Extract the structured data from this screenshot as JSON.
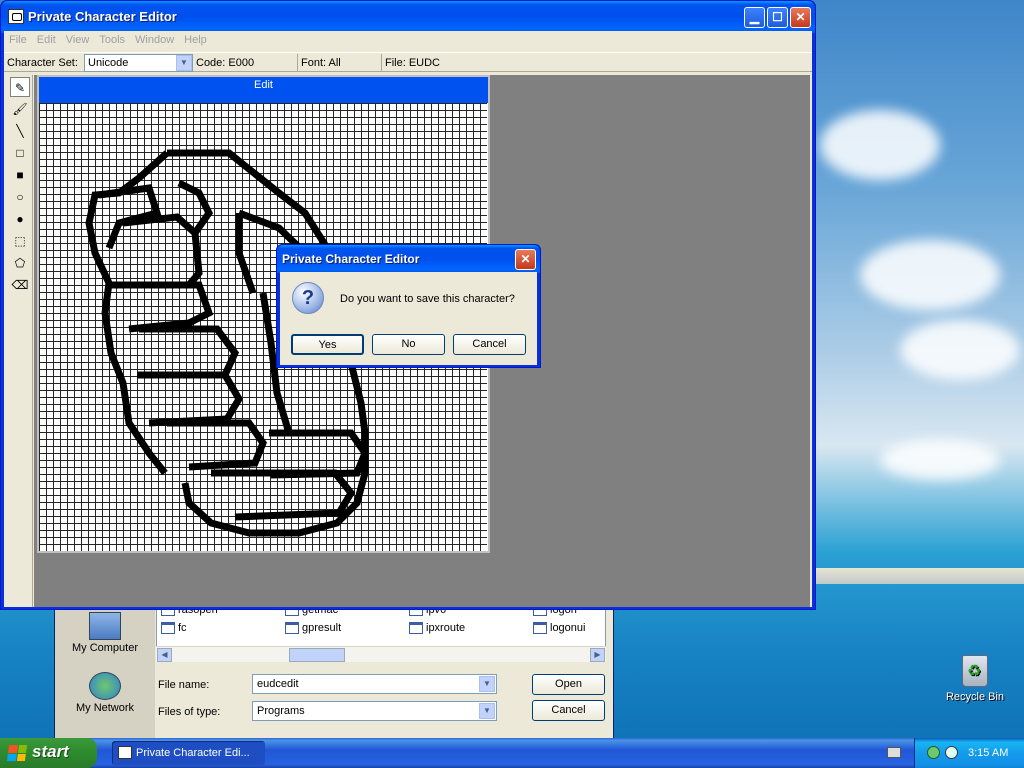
{
  "window": {
    "title": "Private Character Editor",
    "menus": [
      "File",
      "Edit",
      "View",
      "Tools",
      "Window",
      "Help"
    ],
    "charset_label": "Character Set:",
    "charset_value": "Unicode",
    "code": "Code: E000",
    "font": "Font: All",
    "file": "File: EUDC",
    "edit_title": "Edit"
  },
  "tools": [
    "pencil",
    "brush",
    "line",
    "hollow-rectangle",
    "filled-rectangle",
    "hollow-ellipse",
    "filled-ellipse",
    "rectangular-selection",
    "freeform-selection",
    "eraser"
  ],
  "save_dialog": {
    "title": "Private Character Editor",
    "message": "Do you want to save this character?",
    "yes": "Yes",
    "no": "No",
    "cancel": "Cancel"
  },
  "open_dialog": {
    "places": [
      "My Computer",
      "My Network"
    ],
    "files": [
      {
        "name": "rasopen",
        "type": "file"
      },
      {
        "name": "getmac",
        "type": "file"
      },
      {
        "name": "ipv6",
        "type": "file"
      },
      {
        "name": "logon",
        "type": "file"
      },
      {
        "name": "fc",
        "type": "exe"
      },
      {
        "name": "gpresult",
        "type": "exe"
      },
      {
        "name": "ipxroute",
        "type": "exe"
      },
      {
        "name": "logonui",
        "type": "exe"
      }
    ],
    "filename_label": "File name:",
    "filename_value": "eudcedit",
    "filetype_label": "Files of type:",
    "filetype_value": "Programs",
    "open": "Open",
    "cancel": "Cancel"
  },
  "desktop": {
    "recycle_bin": "Recycle Bin"
  },
  "taskbar": {
    "start": "start",
    "task": "Private Character Edi...",
    "clock": "3:15 AM"
  }
}
